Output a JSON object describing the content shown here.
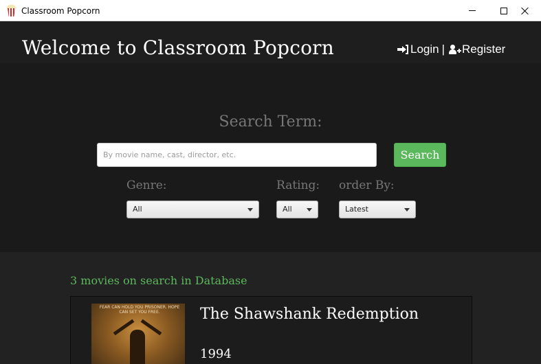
{
  "window": {
    "title": "Classroom Popcorn",
    "app_icon": "popcorn-icon",
    "controls": [
      "minimize-icon",
      "maximize-icon",
      "close-icon"
    ]
  },
  "header": {
    "title": "Welcome to Classroom Popcorn",
    "login_label": "Login",
    "login_icon": "sign-in-icon",
    "separator": "|",
    "register_label": "Register",
    "register_icon": "user-plus-icon"
  },
  "search": {
    "label": "Search Term:",
    "placeholder": "By movie name, cast, director, etc.",
    "value": "",
    "button_label": "Search",
    "filters": {
      "genre": {
        "label": "Genre:",
        "selected": "All"
      },
      "rating": {
        "label": "Rating:",
        "selected": "All"
      },
      "order_by": {
        "label": "order By:",
        "selected": "Latest"
      }
    }
  },
  "results": {
    "count_text": "3 movies on search in Database",
    "movies": [
      {
        "title": "The Shawshank Redemption",
        "year": "1994",
        "poster_caption": "FEAR CAN HOLD YOU PRISONER. HOPE CAN SET YOU FREE."
      }
    ]
  },
  "colors": {
    "accent": "#5cb85c",
    "background": "#222222",
    "header_bg": "#1e1e1e",
    "label_gray": "#777777"
  }
}
